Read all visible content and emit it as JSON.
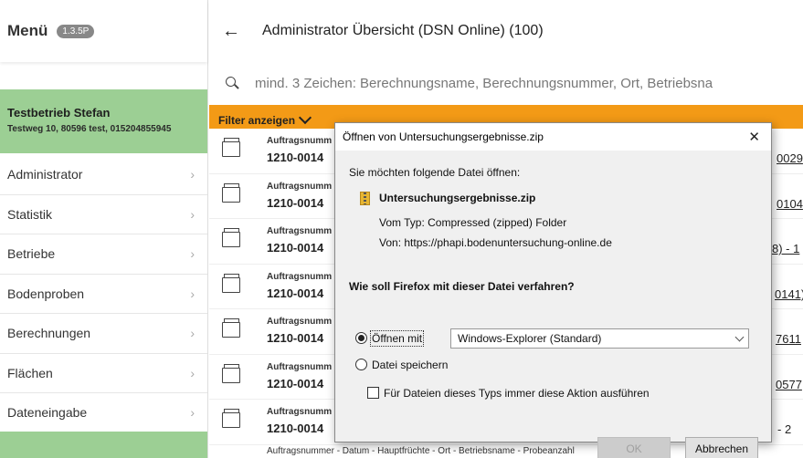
{
  "sidebar": {
    "title": "Menü",
    "version": "1.3.5P",
    "company_name": "Testbetrieb Stefan",
    "company_address": "Testweg 10, 80596 test, 015204855945",
    "items": [
      {
        "label": "Administrator"
      },
      {
        "label": "Statistik"
      },
      {
        "label": "Betriebe"
      },
      {
        "label": "Bodenproben"
      },
      {
        "label": "Berechnungen"
      },
      {
        "label": "Flächen"
      },
      {
        "label": "Dateneingabe"
      }
    ]
  },
  "main": {
    "title": "Administrator Übersicht (DSN Online) (100)",
    "search_placeholder": "mind. 3 Zeichen: Berechnungsname, Berechnungsnummer, Ort, Betriebsna",
    "filter_label": "Filter anzeigen",
    "rows": [
      {
        "label": "Auftragsnumm",
        "number": "1210-0014",
        "tail": "0029"
      },
      {
        "label": "Auftragsnumm",
        "number": "1210-0014",
        "tail": "0104"
      },
      {
        "label": "Auftragsnumm",
        "number": "1210-0014",
        "tail": "8) - 1"
      },
      {
        "label": "Auftragsnumm",
        "number": "1210-0014",
        "tail": "0141)"
      },
      {
        "label": "Auftragsnumm",
        "number": "1210-0014",
        "tail": "7611"
      },
      {
        "label": "Auftragsnumm",
        "number": "1210-0014",
        "tail": "0577"
      },
      {
        "label": "Auftragsnumm",
        "number": "1210-0014",
        "tail": "- 2"
      }
    ],
    "bottom_row_label": "Auftragsnummer - Datum - Hauptfrüchte - Ort - Betriebsname - Probeanzahl"
  },
  "dialog": {
    "title": "Öffnen von Untersuchungsergebnisse.zip",
    "prompt": "Sie möchten folgende Datei öffnen:",
    "filename": "Untersuchungsergebnisse.zip",
    "type_line": "Vom Typ: Compressed (zipped) Folder",
    "from_line": "Von: https://phapi.bodenuntersuchung-online.de",
    "question": "Wie soll Firefox mit dieser Datei verfahren?",
    "open_with_label": "Öffnen mit",
    "open_with_app": "Windows-Explorer (Standard)",
    "save_label": "Datei speichern",
    "always_label": "Für Dateien dieses Typs immer diese Aktion ausführen",
    "ok_label": "OK",
    "cancel_label": "Abbrechen",
    "selected_action": "open"
  }
}
